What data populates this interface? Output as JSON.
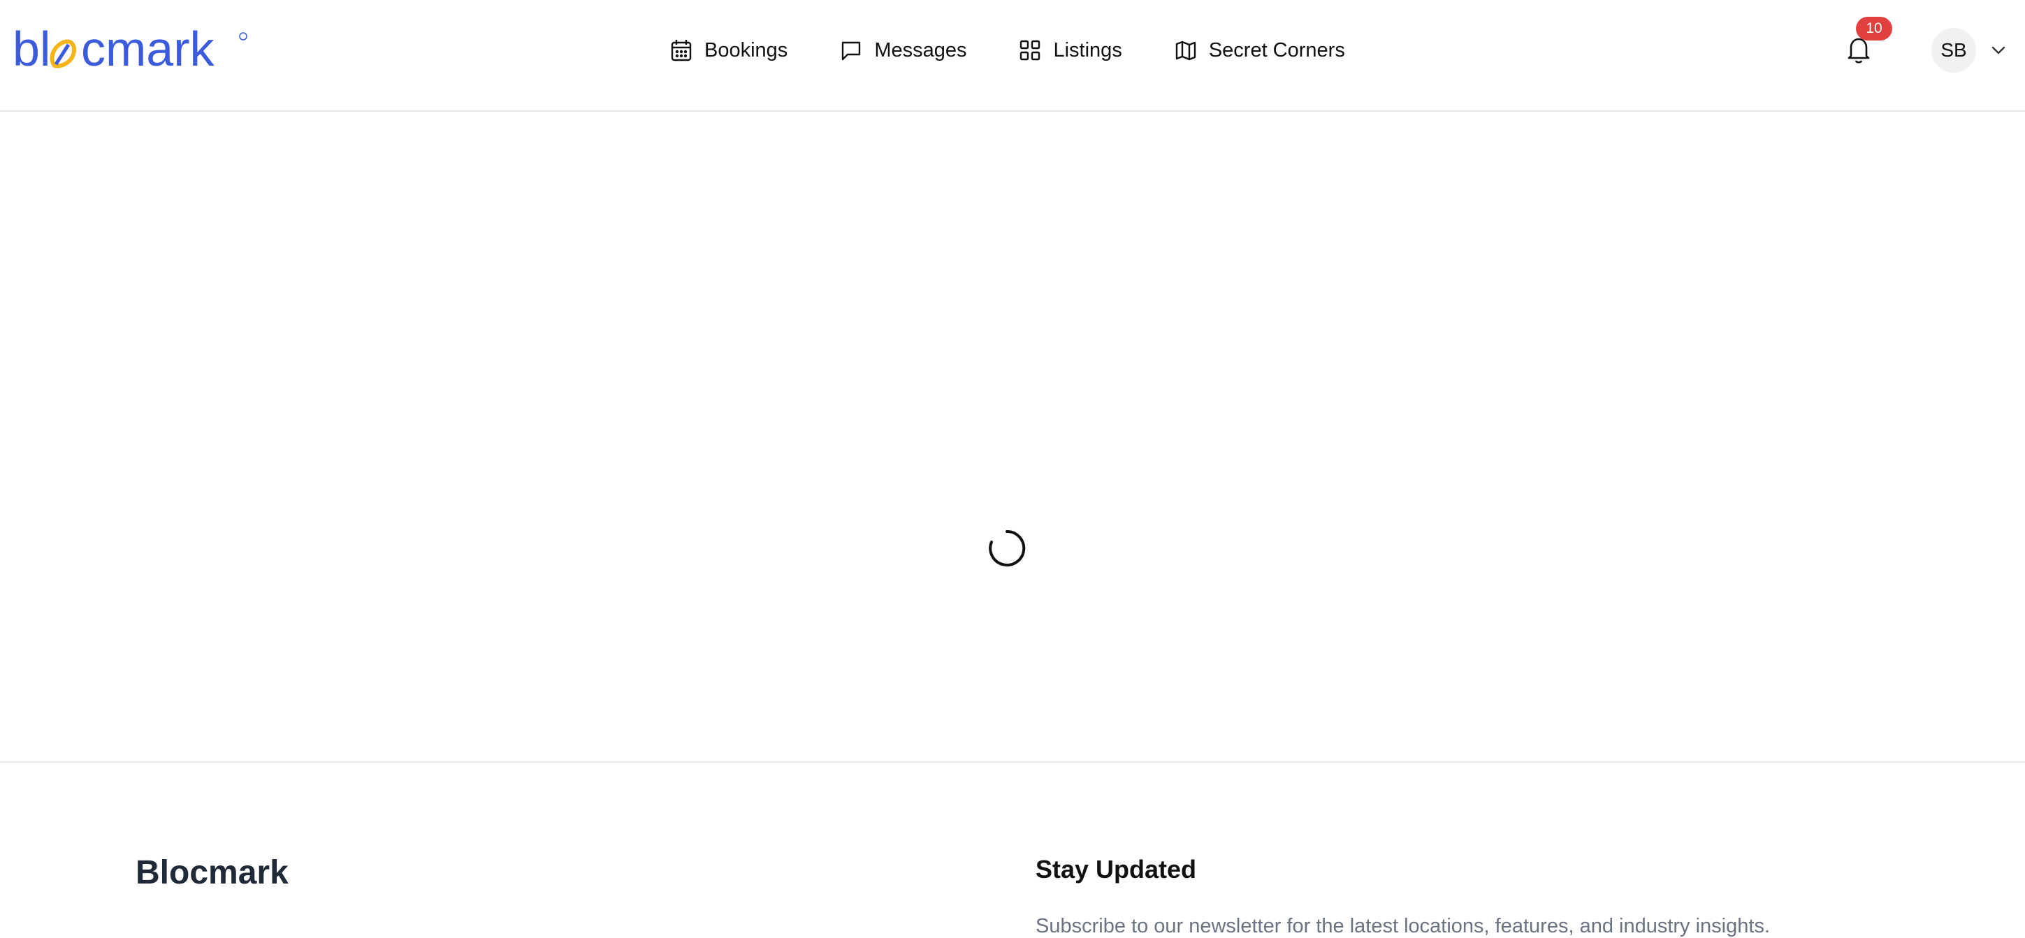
{
  "header": {
    "logo_text": "blocmark",
    "nav": [
      {
        "label": "Bookings",
        "icon": "calendar-icon"
      },
      {
        "label": "Messages",
        "icon": "message-square-icon"
      },
      {
        "label": "Listings",
        "icon": "grid-icon"
      },
      {
        "label": "Secret Corners",
        "icon": "map-icon"
      }
    ],
    "notifications": {
      "icon": "bell-icon",
      "count": "10"
    },
    "user": {
      "initials": "SB",
      "menu_icon": "chevron-down-icon"
    }
  },
  "main": {
    "loading_icon": "spinner-icon"
  },
  "footer": {
    "brand": "Blocmark",
    "newsletter_heading": "Stay Updated",
    "newsletter_text": "Subscribe to our newsletter for the latest locations, features, and industry insights."
  },
  "colors": {
    "brand_blue": "#3b5bdb",
    "brand_yellow": "#f4b41a",
    "badge_red": "#e0413e",
    "border": "#e5e7eb"
  }
}
